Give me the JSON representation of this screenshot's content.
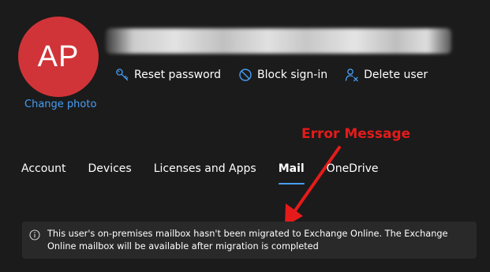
{
  "profile": {
    "initials": "AP",
    "change_photo_label": "Change photo",
    "avatar_color": "#d13438"
  },
  "actions": [
    {
      "label": "Reset password",
      "icon": "key-icon"
    },
    {
      "label": "Block sign-in",
      "icon": "block-icon"
    },
    {
      "label": "Delete user",
      "icon": "delete-user-icon"
    }
  ],
  "annotation": {
    "label": "Error Message",
    "color": "#e51b1b"
  },
  "tabs": [
    {
      "label": "Account",
      "active": false
    },
    {
      "label": "Devices",
      "active": false
    },
    {
      "label": "Licenses and Apps",
      "active": false
    },
    {
      "label": "Mail",
      "active": true
    },
    {
      "label": "OneDrive",
      "active": false
    }
  ],
  "info_bar": {
    "icon": "info-icon",
    "message": "This user's on-premises mailbox hasn't been migrated to Exchange Online. The Exchange Online mailbox will be available after migration is completed"
  },
  "colors": {
    "background": "#1b1b1b",
    "link": "#479ef5",
    "info_bar_bg": "#292929"
  }
}
